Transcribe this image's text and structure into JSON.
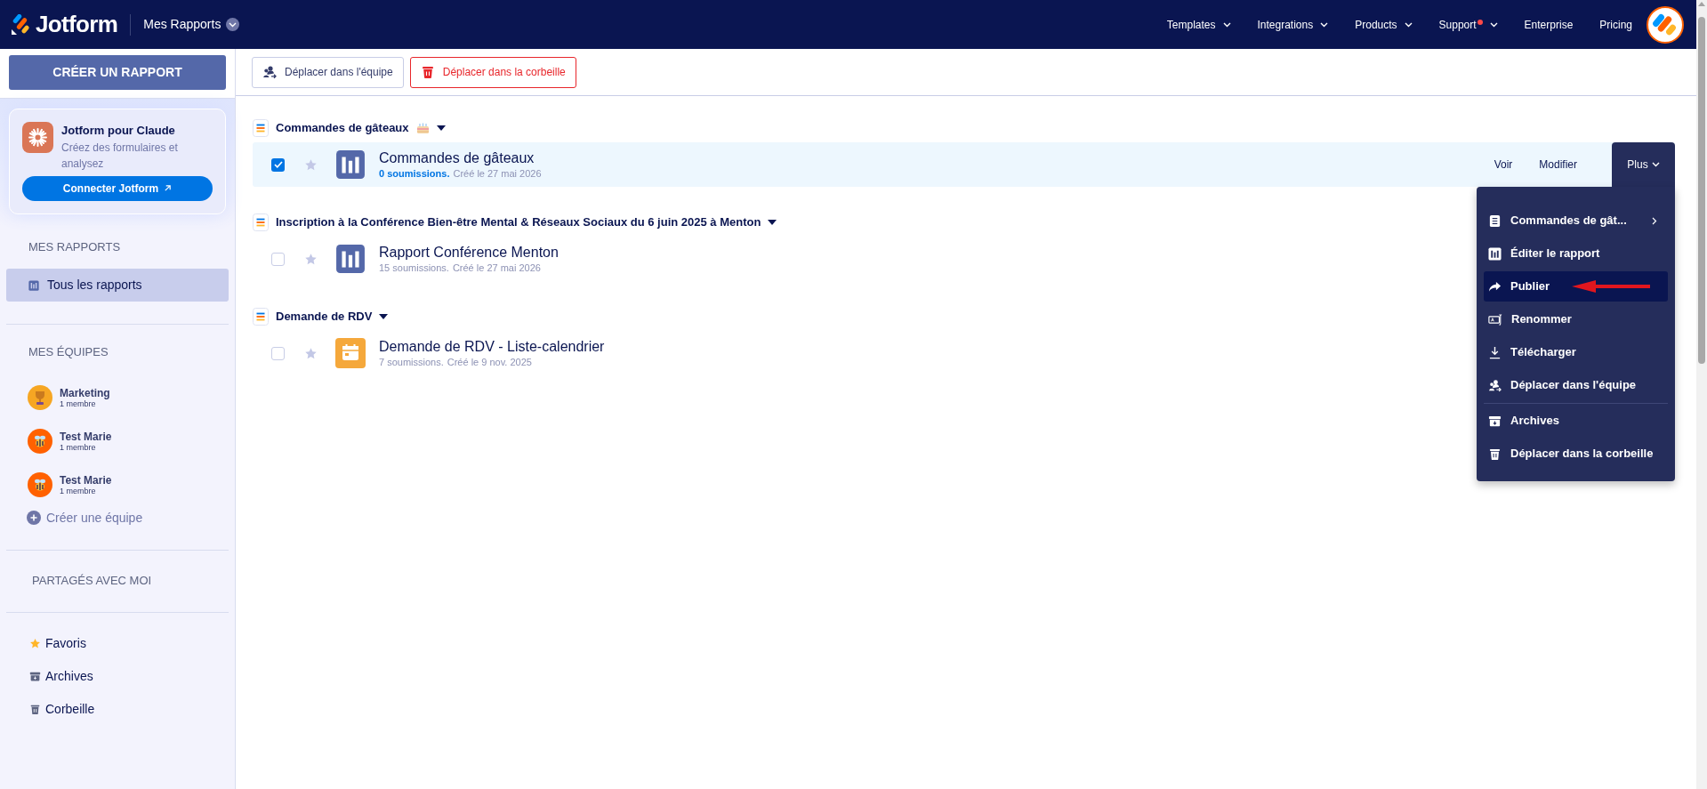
{
  "header": {
    "logo_text": "Jotform",
    "section": "Mes Rapports",
    "nav": [
      {
        "label": "Templates",
        "caret": true,
        "badge": false
      },
      {
        "label": "Integrations",
        "caret": true,
        "badge": false
      },
      {
        "label": "Products",
        "caret": true,
        "badge": false
      },
      {
        "label": "Support",
        "caret": true,
        "badge": true
      },
      {
        "label": "Enterprise",
        "caret": false,
        "badge": false
      },
      {
        "label": "Pricing",
        "caret": false,
        "badge": false
      }
    ]
  },
  "sidebar": {
    "create_button": "CRÉER UN RAPPORT",
    "promo": {
      "title": "Jotform pour Claude",
      "subtitle": "Créez des formulaires et analysez",
      "button": "Connecter Jotform"
    },
    "my_reports": {
      "heading": "MES RAPPORTS",
      "items": [
        {
          "label": "Tous les rapports",
          "selected": true
        }
      ]
    },
    "teams": {
      "heading": "MES ÉQUIPES",
      "items": [
        {
          "name": "Marketing",
          "members": "1 membre",
          "kind": "trophy"
        },
        {
          "name": "Test Marie",
          "members": "1 membre",
          "kind": "bee"
        },
        {
          "name": "Test Marie",
          "members": "1 membre",
          "kind": "bee"
        }
      ],
      "create": "Créer une équipe"
    },
    "shared": {
      "heading": "PARTAGÉS AVEC MOI"
    },
    "links": [
      {
        "label": "Favoris",
        "kind": "star"
      },
      {
        "label": "Archives",
        "kind": "archive"
      },
      {
        "label": "Corbeille",
        "kind": "trash"
      }
    ]
  },
  "toolbar": [
    {
      "label": "Déplacer dans l'équipe",
      "kind": "team"
    },
    {
      "label": "Déplacer dans la corbeille",
      "kind": "trash"
    }
  ],
  "groups": [
    {
      "title": "Commandes de gâteaux",
      "kind": "cake",
      "reports": [
        {
          "title": "Commandes de gâteaux",
          "submissions": "0 soumissions.",
          "created": "Créé le 27 mai 2026",
          "kind": "report",
          "checked": true,
          "actions": [
            "Voir",
            "Modifier",
            "Plus"
          ],
          "menu_sections": [
            {
              "items": [
                {
                  "label": "Commandes de gât...",
                  "kind": "form",
                  "submenu": true,
                  "selected": false
                },
                {
                  "label": "Éditer le rapport",
                  "kind": "report",
                  "submenu": false,
                  "selected": false
                },
                {
                  "label": "Publier",
                  "kind": "share",
                  "submenu": false,
                  "selected": true
                },
                {
                  "label": "Renommer",
                  "kind": "rename",
                  "submenu": false,
                  "selected": false
                },
                {
                  "label": "Télécharger",
                  "kind": "download",
                  "submenu": false,
                  "selected": false
                },
                {
                  "label": "Déplacer dans l'équipe",
                  "kind": "team",
                  "submenu": false,
                  "selected": false
                }
              ]
            },
            {
              "items": [
                {
                  "label": "Archives",
                  "kind": "archive",
                  "submenu": false,
                  "selected": false
                },
                {
                  "label": "Déplacer dans la corbeille",
                  "kind": "trash",
                  "submenu": false,
                  "selected": false
                }
              ]
            }
          ]
        }
      ]
    },
    {
      "title": "Inscription à la Conférence Bien-être Mental & Réseaux Sociaux du 6 juin 2025 à Menton",
      "reports": [
        {
          "title": "Rapport Conférence Menton",
          "submissions": "15 soumissions.",
          "created": "Créé le 27 mai 2026",
          "kind": "report",
          "checked": false
        }
      ]
    },
    {
      "title": "Demande de RDV",
      "reports": [
        {
          "title": "Demande de RDV - Liste-calendrier",
          "submissions": "7 soumissions.",
          "created": "Créé le 9 nov. 2025",
          "kind": "calendar",
          "checked": false
        }
      ]
    }
  ]
}
